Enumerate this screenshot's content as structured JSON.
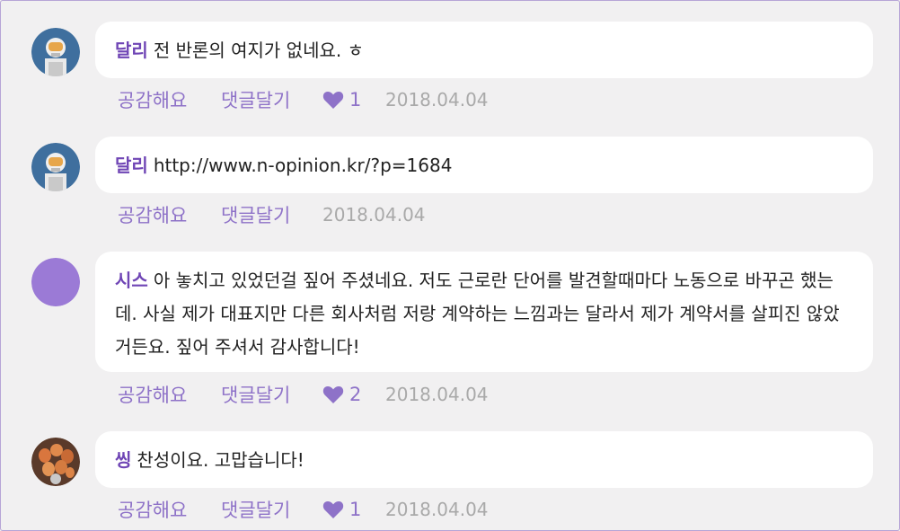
{
  "comments": [
    {
      "author": "달리",
      "text": "전 반론의 여지가 없네요. ㅎ",
      "like_label": "공감해요",
      "reply_label": "댓글달기",
      "likes": "1",
      "date": "2018.04.04",
      "avatar": "astronaut-avatar"
    },
    {
      "author": "달리",
      "text": "http://www.n-opinion.kr/?p=1684",
      "like_label": "공감해요",
      "reply_label": "댓글달기",
      "likes": "",
      "date": "2018.04.04",
      "avatar": "astronaut-avatar"
    },
    {
      "author": "시스",
      "text": "아 놓치고 있었던걸 짚어 주셨네요. 저도 근로란 단어를 발견할때마다 노동으로 바꾸곤 했는데. 사실 제가 대표지만 다른 회사처럼 저랑 계약하는 느낌과는 달라서 제가 계약서를 살피진 않았거든요. 짚어 주셔서 감사합니다!",
      "like_label": "공감해요",
      "reply_label": "댓글달기",
      "likes": "2",
      "date": "2018.04.04",
      "avatar": "purple-circle-avatar"
    },
    {
      "author": "씽",
      "text": "찬성이요. 고맙습니다!",
      "like_label": "공감해요",
      "reply_label": "댓글달기",
      "likes": "1",
      "date": "2018.04.04",
      "avatar": "eggs-avatar"
    }
  ],
  "colors": {
    "accent": "#6f45b5",
    "action": "#8e72c8",
    "date": "#a9a9a9",
    "background": "#f1f0f1",
    "bubble": "#ffffff"
  }
}
